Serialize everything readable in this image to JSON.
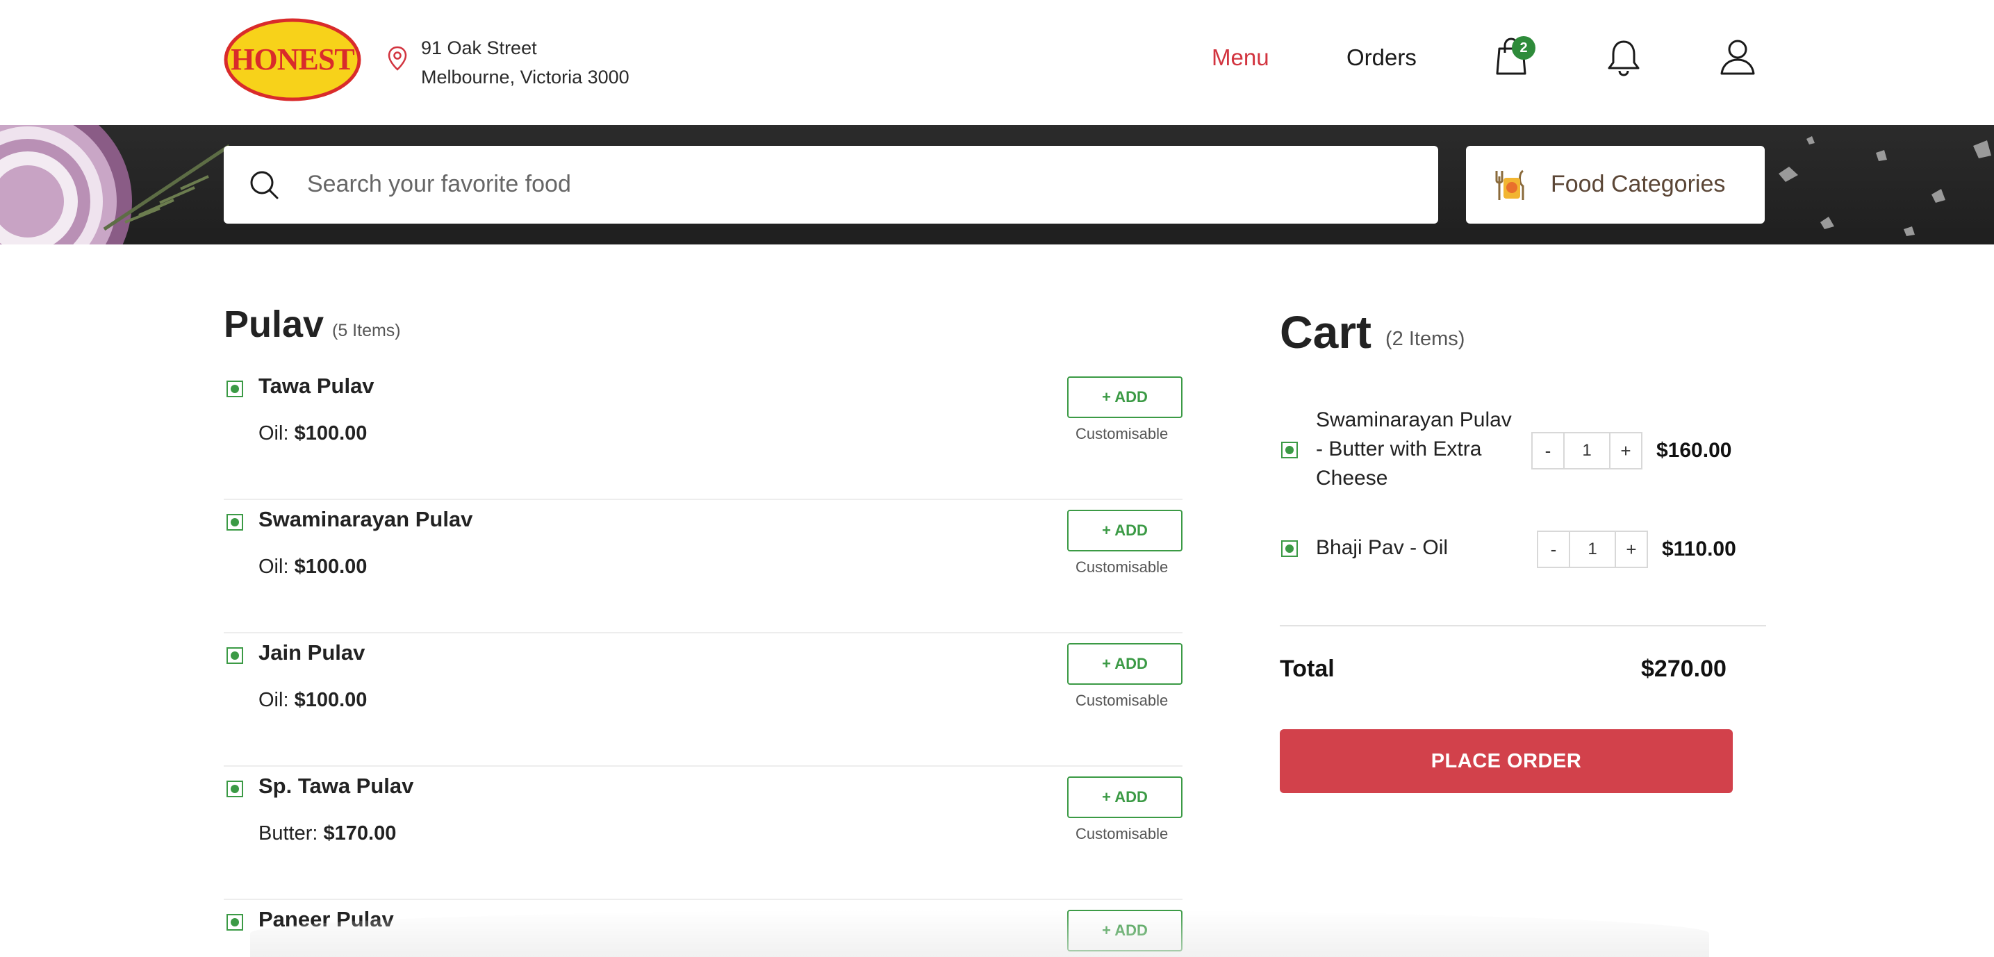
{
  "header": {
    "brand": "HONEST",
    "address_line1": "91 Oak Street",
    "address_line2": "Melbourne, Victoria 3000",
    "nav_menu": "Menu",
    "nav_orders": "Orders",
    "cart_badge": "2",
    "accent_color": "#d2343f",
    "badge_color": "#2e8b3a"
  },
  "search": {
    "placeholder": "Search your favorite food",
    "categories_label": "Food Categories"
  },
  "menu": {
    "title": "Pulav",
    "count": "(5 Items)",
    "add_label": "+ ADD",
    "customisable_label": "Customisable",
    "items": [
      {
        "name": "Tawa Pulav",
        "variant": "Oil:",
        "price": "$100.00"
      },
      {
        "name": "Swaminarayan Pulav",
        "variant": "Oil:",
        "price": "$100.00"
      },
      {
        "name": "Jain Pulav",
        "variant": "Oil:",
        "price": "$100.00"
      },
      {
        "name": "Sp. Tawa Pulav",
        "variant": "Butter:",
        "price": "$170.00"
      },
      {
        "name": "Paneer Pulav",
        "variant": "",
        "price": ""
      }
    ]
  },
  "cart": {
    "title": "Cart",
    "count": "(2 Items)",
    "items": [
      {
        "name_line1": "Swaminarayan Pulav",
        "name_line2": "- Butter with Extra",
        "name_line3": "Cheese",
        "qty": "1",
        "price": "$160.00"
      },
      {
        "name_line1": "Bhaji Pav - Oil",
        "qty": "1",
        "price": "$110.00"
      }
    ],
    "minus": "-",
    "plus": "+",
    "total_label": "Total",
    "total_value": "$270.00",
    "place_order": "PLACE ORDER",
    "button_color": "#d2414b"
  }
}
